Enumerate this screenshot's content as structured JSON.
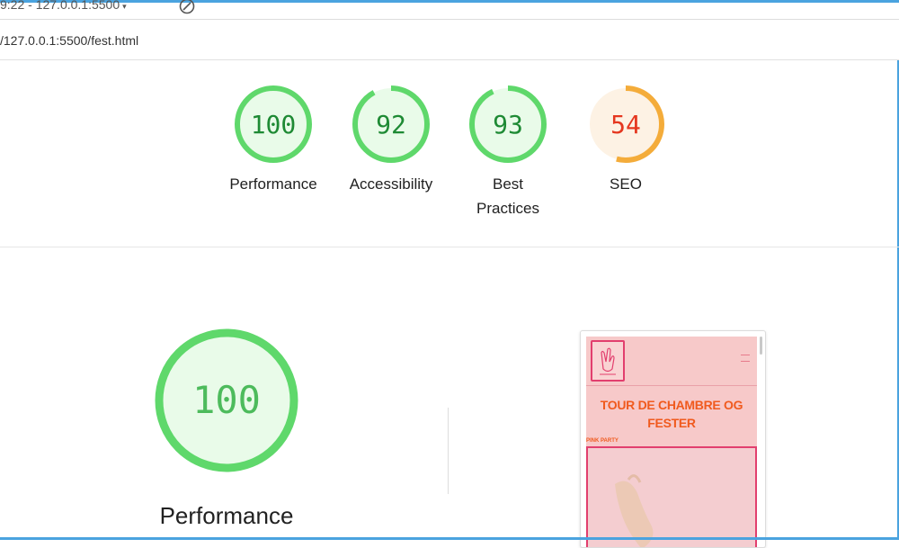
{
  "topbar": {
    "session_label": "9:22 - 127.0.0.1:5500",
    "dropdown_chevron": "▾",
    "icon": "gauge-icon"
  },
  "url": "/127.0.0.1:5500/fest.html",
  "scores": [
    {
      "label": "Performance",
      "value": "100",
      "fraction": 1.0,
      "color": "#0cce6b"
    },
    {
      "label": "Accessibility",
      "value": "92",
      "fraction": 0.92,
      "color": "#0cce6b"
    },
    {
      "label": "Best Practices",
      "value": "93",
      "fraction": 0.93,
      "color": "#0cce6b"
    },
    {
      "label": "SEO",
      "value": "54",
      "fraction": 0.54,
      "color": "#ffa400"
    }
  ],
  "colors": {
    "pass_ring": "#5fd86b",
    "pass_fill": "#e9fbe9",
    "pass_text": "#1e8a34",
    "avg_ring": "#f4ac3a",
    "avg_fill": "#fdf2e4",
    "avg_text": "#e5371f"
  },
  "performance_section": {
    "score": "100",
    "fraction": 1.0,
    "title": "Performance"
  },
  "preview": {
    "heading": "TOUR DE CHAMBRE OG FESTER",
    "subheading": "PINK PARTY"
  }
}
